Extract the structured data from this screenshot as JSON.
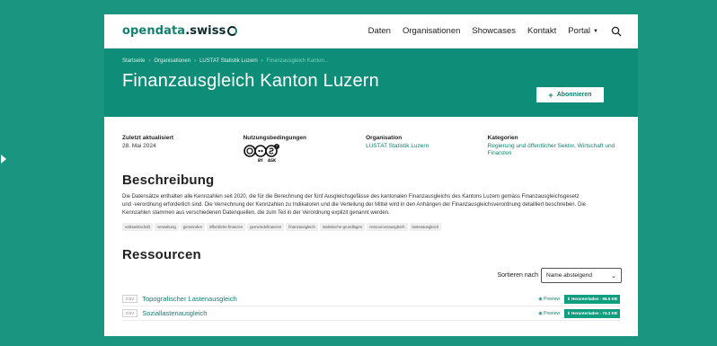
{
  "colors": {
    "page_bg": "#1a9680",
    "hero_bg": "#0e8e78",
    "accent": "#13826f",
    "download_bg": "#0f9e7f"
  },
  "header": {
    "logo_part1": "opendata",
    "logo_part2": ".swiss",
    "logo_icon": "ring-icon",
    "nav": [
      "Daten",
      "Organisationen",
      "Showcases",
      "Kontakt",
      "Portal"
    ],
    "search_icon": "search-icon"
  },
  "hero": {
    "breadcrumbs": [
      "Startseite",
      "Organisationen",
      "LUSTAT Statistik Luzern",
      "Finanzausgleich Kanton..."
    ],
    "title": "Finanzausgleich Kanton Luzern",
    "subscribe_label": "Abonnieren"
  },
  "meta": {
    "updated_label": "Zuletzt aktualisiert",
    "updated_value": "28. Mai 2024",
    "terms_label": "Nutzungsbedingungen",
    "terms_badges": [
      "BY",
      "ASK"
    ],
    "org_label": "Organisation",
    "org_value": "LUSTAT Statistik Luzern",
    "categories_label": "Kategorien",
    "categories_value": "Regierung und öffentlicher Sektor, Wirtschaft und Finanzen"
  },
  "description": {
    "heading": "Beschreibung",
    "text": "Die Datensätze enthalten alle Kennzahlen seit 2020, die für die Berechnung der fünf Ausgleichsgefässe des kantonalen Finanzausgleichs des Kantons Luzern gemäss Finanzausgleichsgesetz und -verordnung erforderlich sind. Die Verrechnung der Kennzahlen zu Indikatoren und die Verteilung der Mittel wird in den Anhängen der Finanzausgleichsverordnung detailliert beschrieben. Die Kennzahlen stammen aus verschiedenen Datenquellen, die zum Teil in der Verordnung explizit genannt werden.",
    "tags": [
      "volkswirtschaft",
      "verwaltung",
      "gemeinden",
      "öffentliche-finanzen",
      "gemeindefinanzen",
      "finanzausgleich",
      "statistische-grundlagen",
      "ressourcenausgleich",
      "lastenausgleich"
    ]
  },
  "resources": {
    "heading": "Ressourcen",
    "sort_label": "Sortieren nach",
    "sort_value": "Name absteigend",
    "items": [
      {
        "format": "CSV",
        "name": "Topografischer Lastenausgleich",
        "preview": "Preview",
        "download": "Herunterladen - 96.5 KB"
      },
      {
        "format": "CSV",
        "name": "Soziallastenausgleich",
        "preview": "Preview",
        "download": "Herunterladen - 74.3 KB"
      }
    ]
  }
}
